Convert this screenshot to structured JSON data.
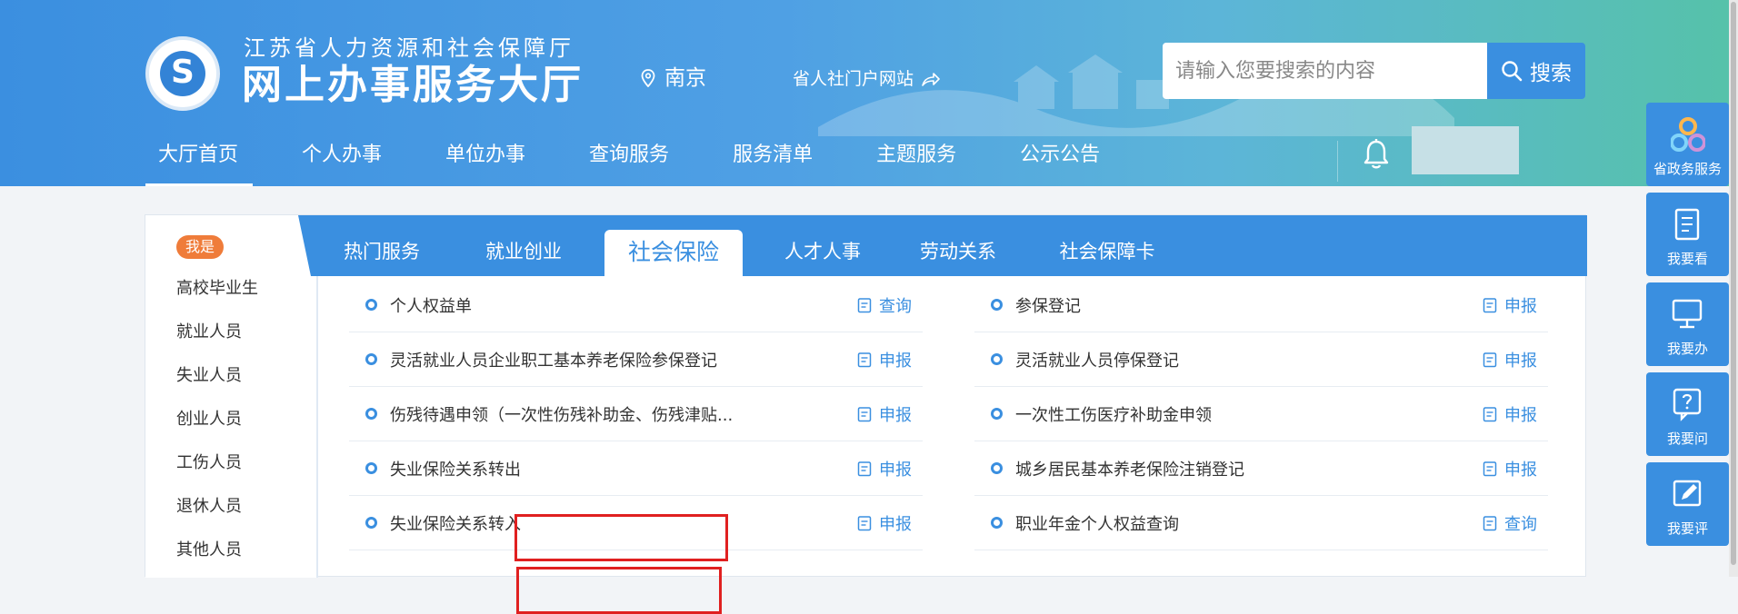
{
  "header": {
    "subtitle": "江苏省人力资源和社会保障厅",
    "title": "网上办事服务大厅",
    "location": "南京",
    "portal_link": "省人社门户网站",
    "search_placeholder": "请输入您要搜索的内容",
    "search_button": "搜索",
    "logo_icon": "logo-icon",
    "bell_icon": "bell-icon"
  },
  "nav": [
    {
      "label": "大厅首页",
      "active": true
    },
    {
      "label": "个人办事"
    },
    {
      "label": "单位办事"
    },
    {
      "label": "查询服务"
    },
    {
      "label": "服务清单"
    },
    {
      "label": "主题服务"
    },
    {
      "label": "公示公告"
    }
  ],
  "sidebar": {
    "badge": "我是",
    "items": [
      "高校毕业生",
      "就业人员",
      "失业人员",
      "创业人员",
      "工伤人员",
      "退休人员",
      "其他人员"
    ]
  },
  "tabs": [
    {
      "label": "热门服务"
    },
    {
      "label": "就业创业"
    },
    {
      "label": "社会保险",
      "active": true
    },
    {
      "label": "人才人事"
    },
    {
      "label": "劳动关系"
    },
    {
      "label": "社会保障卡"
    }
  ],
  "services": {
    "left": [
      {
        "label": "个人权益单",
        "action": "查询"
      },
      {
        "label": "灵活就业人员企业职工基本养老保险参保登记",
        "action": "申报"
      },
      {
        "label": "伤残待遇申领（一次性伤残补助金、伤残津贴...",
        "action": "申报"
      },
      {
        "label": "失业保险关系转出",
        "action": "申报",
        "highlighted": true
      },
      {
        "label": "失业保险关系转入",
        "action": "申报",
        "highlighted": true
      }
    ],
    "right": [
      {
        "label": "参保登记",
        "action": "申报"
      },
      {
        "label": "灵活就业人员停保登记",
        "action": "申报"
      },
      {
        "label": "一次性工伤医疗补助金申领",
        "action": "申报"
      },
      {
        "label": "城乡居民基本养老保险注销登记",
        "action": "申报"
      },
      {
        "label": "职业年金个人权益查询",
        "action": "查询"
      }
    ]
  },
  "float_bar": [
    {
      "label": "省政务服务",
      "icon": "gov-service-icon"
    },
    {
      "label": "我要看",
      "icon": "notebook-icon"
    },
    {
      "label": "我要办",
      "icon": "monitor-icon"
    },
    {
      "label": "我要问",
      "icon": "question-icon"
    },
    {
      "label": "我要评",
      "icon": "pen-icon"
    }
  ],
  "colors": {
    "primary": "#3a8fe0",
    "badge": "#ef7c3a",
    "highlight": "#e02020"
  }
}
